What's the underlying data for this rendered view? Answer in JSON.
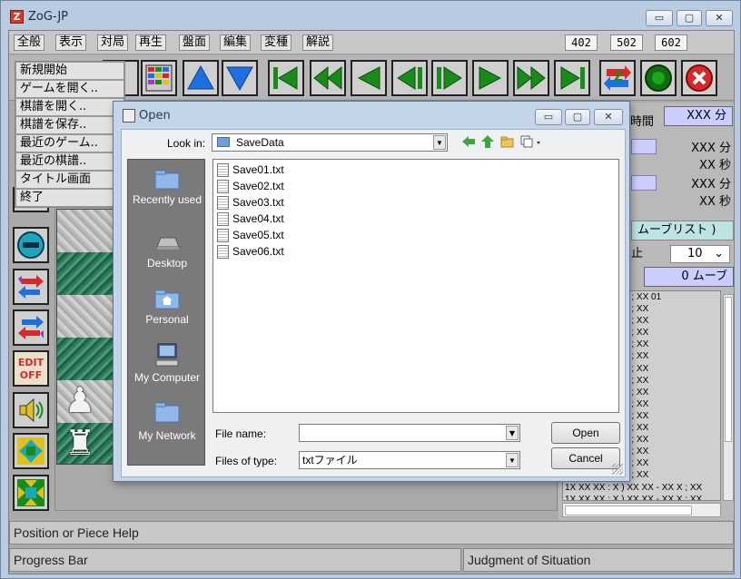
{
  "window": {
    "title": "ZoG-JP",
    "app_icon_letter": "Z",
    "min_glyph": "▭",
    "max_glyph": "▢",
    "close_glyph": "✕"
  },
  "menubar": {
    "items": [
      "全般",
      "表示",
      "対局",
      "再生",
      "盤面",
      "編集",
      "変種",
      "解説"
    ],
    "num_buttons": [
      "402",
      "502",
      "602"
    ]
  },
  "general_menu": {
    "items": [
      "新規開始",
      "ゲームを開く..",
      "棋譜を開く..",
      "棋譜を保存..",
      "最近のゲーム..",
      "最近の棋譜..",
      "タイトル画面",
      "終了"
    ]
  },
  "toolbar": {
    "icons": [
      "board-view-icon",
      "arrow-up-icon",
      "arrow-down-icon",
      "first-move-icon",
      "fast-back-icon",
      "back-icon",
      "step-back-icon",
      "step-forward-icon",
      "forward-icon",
      "fast-forward-icon",
      "last-move-icon",
      "swap-sides-icon",
      "go-icon",
      "stop-icon"
    ],
    "colors": {
      "blue": "#1e6fe0",
      "green": "#1a8a1a",
      "red": "#d62a2a"
    }
  },
  "leftbar": {
    "icons": [
      "circle-yellow-icon",
      "minus-circle-icon",
      "swap-arrows-icon",
      "swap-arrows-alt-icon",
      "edit-off-icon",
      "sound-icon",
      "expand-icon",
      "collapse-icon"
    ],
    "edit_text_1": "EDIT",
    "edit_text_2": "OFF"
  },
  "right_panel": {
    "time_label": "時間",
    "total_time": "XXX 分",
    "p1_min": "XXX 分",
    "p1_sec": "XX 秒",
    "p2_min": "XXX 分",
    "p2_sec": "XX 秒",
    "movelist_header": "ムーブリスト )",
    "stop_label": "止",
    "depth_value": "10",
    "move_count": "0 ムーブ",
    "moves": [
      "X XX XX - XX X ; XX 01",
      "X XX XX - XX X ; XX",
      "X XX XX - XX X ; XX",
      "X XX XX - XX X ; XX",
      "X XX XX - XX X ; XX",
      "X XX XX - XX X ; XX",
      "X XX XX - XX X ; XX",
      "X XX XX - XX X ; XX",
      "X XX XX - XX X ; XX",
      "X XX XX - XX X ; XX",
      "X XX XX - XX X ; XX",
      "X XX XX - XX X ; XX",
      "X XX XX - XX X ; XX",
      "X XX XX - XX X ; XX",
      "X XX XX - XX X ; XX",
      "X XX XX - XX X ; XX",
      "1X XX XX : X ) XX XX - XX X ; XX",
      "1X XX XX : X ) XX XX - XX X ; XX"
    ]
  },
  "status": {
    "position_help": "Position or Piece Help",
    "progress": "Progress Bar",
    "judgment": "Judgment of Situation"
  },
  "open_dialog": {
    "title": "Open",
    "look_in_label": "Look in:",
    "look_in_value": "SaveData",
    "places": [
      "Recently used",
      "Desktop",
      "Personal",
      "My Computer",
      "My Network"
    ],
    "files": [
      "Save01.txt",
      "Save02.txt",
      "Save03.txt",
      "Save04.txt",
      "Save05.txt",
      "Save06.txt"
    ],
    "file_name_label": "File name:",
    "file_name_value": "",
    "files_of_type_label": "Files of type:",
    "files_of_type_value": "txtファイル",
    "open_button": "Open",
    "cancel_button": "Cancel"
  }
}
